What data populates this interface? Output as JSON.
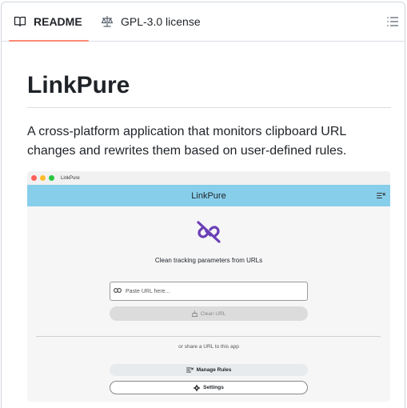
{
  "tabs": {
    "readme": {
      "label": "README",
      "icon": "book-icon",
      "active": true,
      "underline_color": "#fd8c73"
    },
    "license": {
      "label": "GPL-3.0 license",
      "icon": "law-icon"
    },
    "outline_icon": "list-unordered-icon"
  },
  "readme": {
    "title": "LinkPure",
    "description": "A cross-platform application that monitors clipboard URL changes and rewrites them based on user-defined rules."
  },
  "screenshot": {
    "window_title": "LinkPure",
    "traffic_lights": [
      "#ff5f57",
      "#febc2e",
      "#28c840"
    ],
    "appbar": {
      "title": "LinkPure",
      "color": "#87ceeb",
      "icon": "rules-icon"
    },
    "hero_icon": "broken-link-icon",
    "hero_color": "#6a3fb5",
    "tagline": "Clean tracking parameters from URLs",
    "url_input": {
      "placeholder": "Paste URL here...",
      "value": ""
    },
    "clean_button": {
      "label": "Clean URL",
      "disabled": true
    },
    "share_text": "or share a URL to this app",
    "manage_rules_button": {
      "label": "Manage Rules"
    },
    "settings_button": {
      "label": "Settings"
    }
  }
}
